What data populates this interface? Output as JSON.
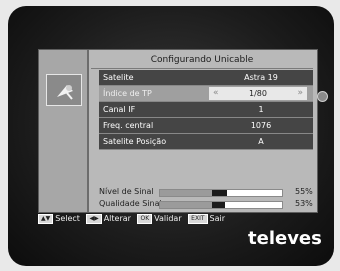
{
  "screen": {
    "title": "Configurando Unicable",
    "rows": [
      {
        "label": "Satelite",
        "value": "Astra 19"
      },
      {
        "label": "Índice de TP",
        "value": "1/80",
        "selected": true
      },
      {
        "label": "Canal IF",
        "value": "1"
      },
      {
        "label": "Freq. central",
        "value": "1076"
      },
      {
        "label": "Satelite Posição",
        "value": "A"
      }
    ],
    "meters": [
      {
        "label": "Nível de Sinal",
        "percent": "55%",
        "level": 0.55
      },
      {
        "label": "Qualidade Sinal",
        "percent": "53%",
        "level": 0.53
      }
    ]
  },
  "help": {
    "select": "Select",
    "alter": "Alterar",
    "validate": "Validar",
    "exit_key": "EXIT",
    "exit": "Sair"
  },
  "brand": "televes"
}
